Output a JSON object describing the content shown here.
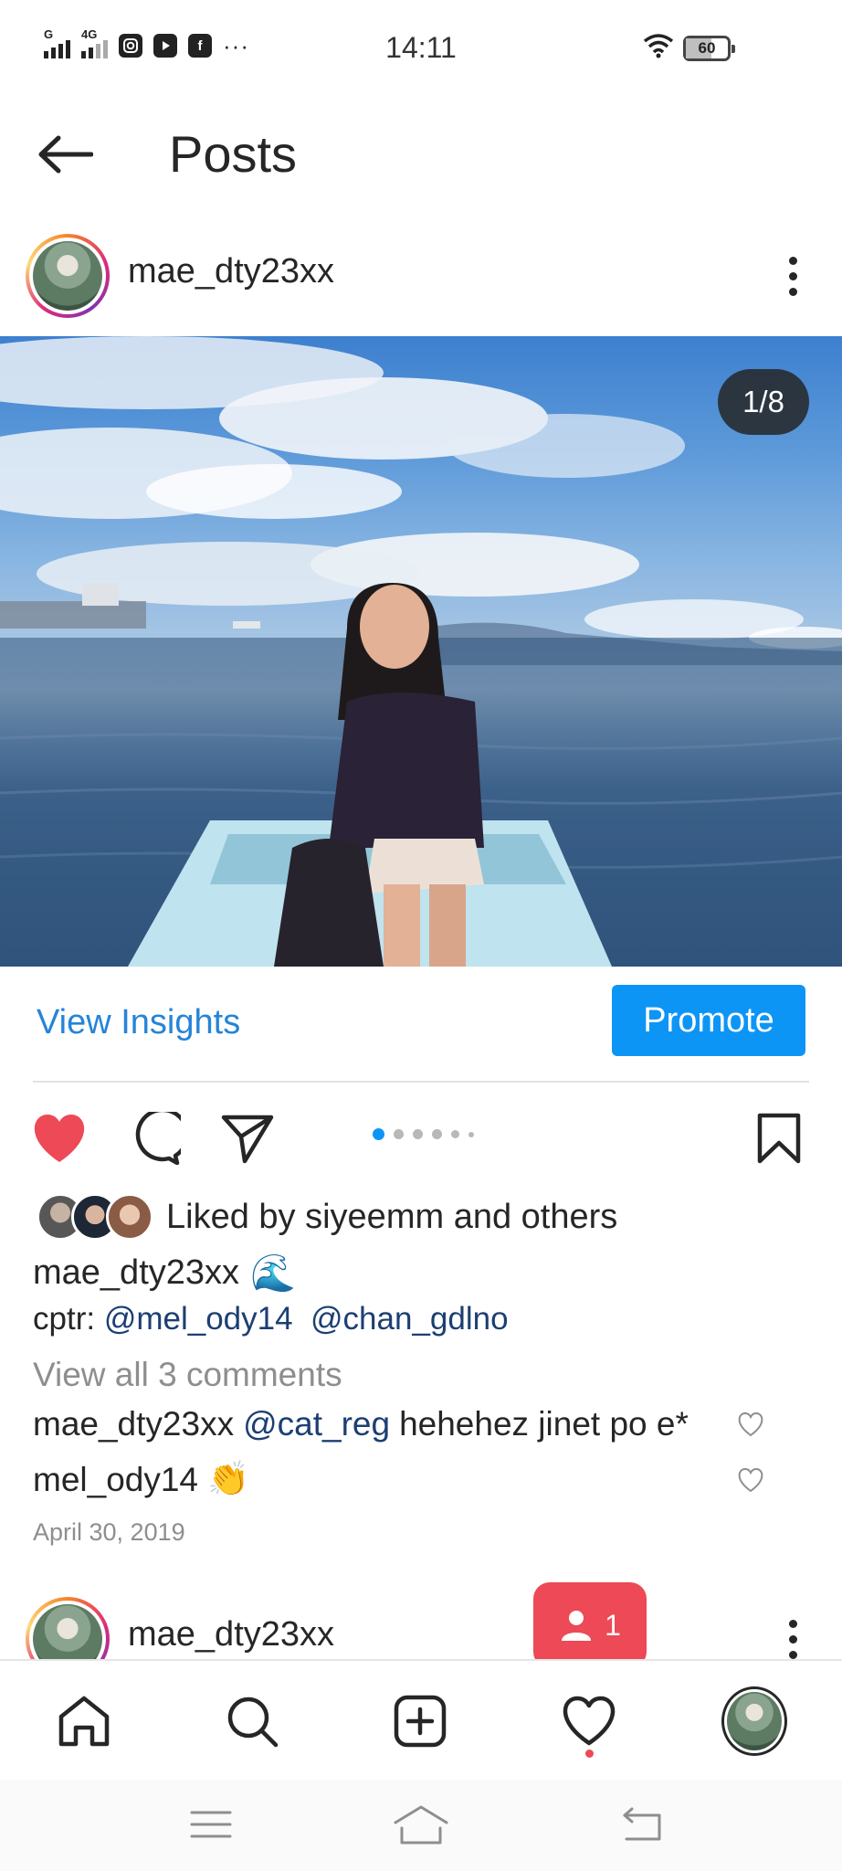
{
  "status_bar": {
    "network_tag_1": "G",
    "network_tag_2": "4G",
    "time": "14:11",
    "battery": "60",
    "app_icons": [
      "instagram-icon",
      "youtube-icon",
      "facebook-icon"
    ],
    "more": "···"
  },
  "header": {
    "title": "Posts",
    "back_icon": "arrow-left-icon"
  },
  "post": {
    "username": "mae_dty23xx",
    "image_counter": "1/8",
    "view_insights_label": "View Insights",
    "promote_label": "Promote",
    "carousel": {
      "total": 6,
      "active": 0
    },
    "liked_by_prefix": "Liked by",
    "liked_by_user": "siyeemm",
    "liked_by_mid": "and",
    "liked_by_others": "others",
    "caption_user": "mae_dty23xx",
    "caption_emoji": "🌊",
    "credit_prefix": "cptr:",
    "credit_mention_1": "@mel_ody14",
    "credit_mention_2": "@chan_gdlno",
    "view_comments": "View all 3 comments",
    "comments": [
      {
        "user": "mae_dty23xx",
        "mention": "@cat_reg",
        "text": "hehehez jinet po e*"
      },
      {
        "user": "mel_ody14",
        "text": "👏"
      }
    ],
    "date": "April 30, 2019"
  },
  "next_post": {
    "username": "mae_dty23xx"
  },
  "notification": {
    "count": "1",
    "icon": "person-icon"
  },
  "bottom_nav": {
    "items": [
      "home-icon",
      "search-icon",
      "new-post-icon",
      "activity-heart-icon",
      "profile-avatar"
    ]
  },
  "system_nav": {
    "items": [
      "menu-icon",
      "home-icon",
      "back-icon"
    ]
  },
  "colors": {
    "accent_blue": "#0d95f6",
    "link_blue": "#2584d8",
    "like_red": "#ed4956",
    "mention_navy": "#1c3f73"
  }
}
